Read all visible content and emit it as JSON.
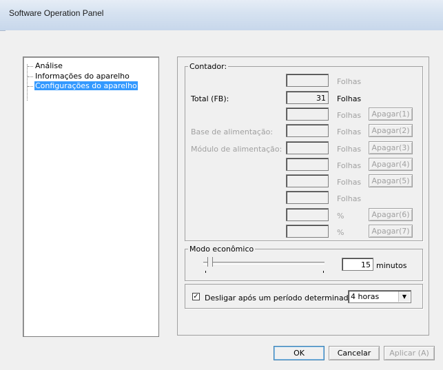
{
  "window": {
    "title": "Software Operation Panel"
  },
  "tree": {
    "items": [
      {
        "label": "Análise"
      },
      {
        "label": "Informações do aparelho"
      },
      {
        "label": "Configurações do aparelho",
        "selected": true
      }
    ]
  },
  "contador": {
    "legend": "Contador:",
    "rows": [
      {
        "label": "",
        "value": "",
        "unit": "Folhas",
        "button": ""
      },
      {
        "label": "Total (FB):",
        "value": "31",
        "unit": "Folhas",
        "button": ""
      },
      {
        "label": "",
        "value": "",
        "unit": "Folhas",
        "button": "Apagar(1)"
      },
      {
        "label": "Base de alimentação:",
        "value": "",
        "unit": "Folhas",
        "button": "Apagar(2)"
      },
      {
        "label": "Módulo de alimentação:",
        "value": "",
        "unit": "Folhas",
        "button": "Apagar(3)"
      },
      {
        "label": "",
        "value": "",
        "unit": "Folhas",
        "button": "Apagar(4)"
      },
      {
        "label": "",
        "value": "",
        "unit": "Folhas",
        "button": "Apagar(5)"
      },
      {
        "label": "",
        "value": "",
        "unit": "Folhas",
        "button": ""
      },
      {
        "label": "",
        "value": "",
        "unit": "%",
        "button": "Apagar(6)"
      },
      {
        "label": "",
        "value": "",
        "unit": "%",
        "button": "Apagar(7)"
      }
    ]
  },
  "modo": {
    "legend": "Modo econômico",
    "value": "15",
    "unit": "minutos"
  },
  "desligar": {
    "label": "Desligar após um período determinado",
    "checked": true,
    "selected": "4 horas"
  },
  "buttons": {
    "ok": "OK",
    "cancel": "Cancelar",
    "apply": "Aplicar (A)"
  }
}
